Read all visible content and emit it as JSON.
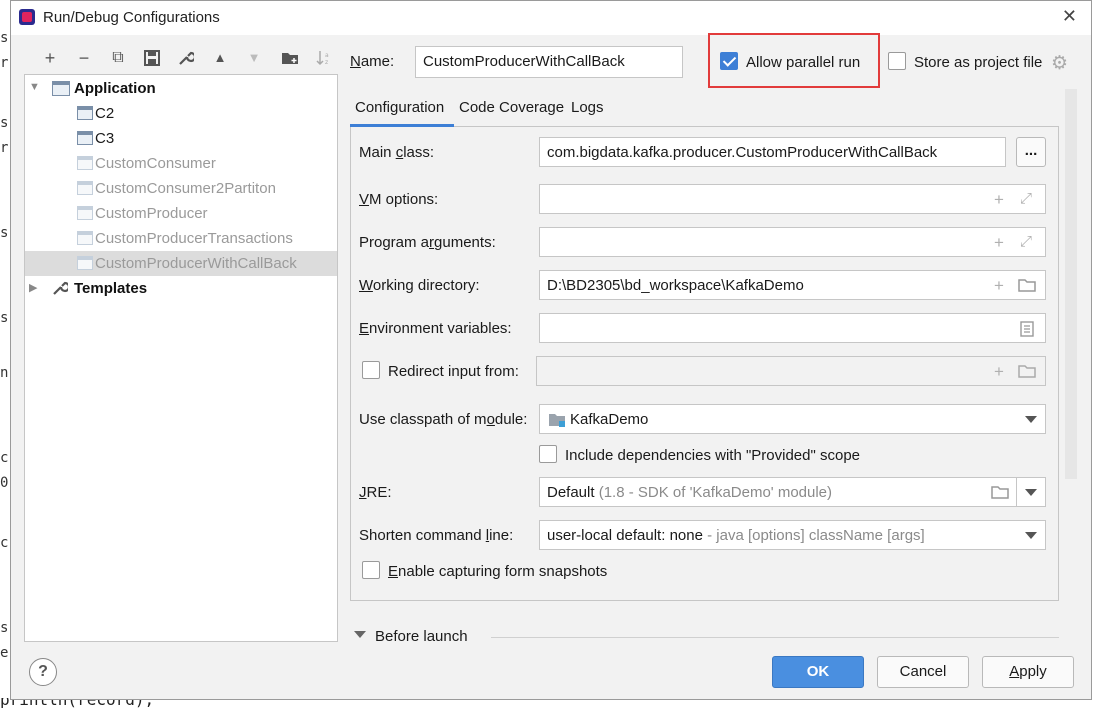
{
  "window": {
    "title": "Run/Debug Configurations",
    "close_glyph": "✕"
  },
  "background": {
    "edge_chars": [
      "s",
      "r",
      "s",
      "r",
      "s",
      "s",
      "n",
      "c",
      "0",
      "c",
      "s",
      "e"
    ],
    "bottom_code": "println(record);"
  },
  "toolbar": {
    "icons": [
      "plus-icon",
      "minus-icon",
      "copy-icon",
      "save-icon",
      "wrench-icon",
      "arrow-up-icon",
      "arrow-down-icon",
      "folder-add-icon",
      "sort-icon"
    ],
    "glyphs": {
      "add": "+",
      "remove": "−",
      "copy": "⧉",
      "save": "🖫",
      "wrench": "🔧",
      "up": "▲",
      "down": "▼",
      "folder": "📁",
      "sort": "↓"
    }
  },
  "tree": {
    "application_label": "Application",
    "items": [
      {
        "label": "C2",
        "enabled": true
      },
      {
        "label": "C3",
        "enabled": true
      },
      {
        "label": "CustomConsumer",
        "enabled": false
      },
      {
        "label": "CustomConsumer2Partiton",
        "enabled": false
      },
      {
        "label": "CustomProducer",
        "enabled": false
      },
      {
        "label": "CustomProducerTransactions",
        "enabled": false
      },
      {
        "label": "CustomProducerWithCallBack",
        "enabled": false,
        "selected": true
      }
    ],
    "templates_label": "Templates"
  },
  "header": {
    "name_label": "Name:",
    "name_value": "CustomProducerWithCallBack",
    "allow_parallel_label": "Allow parallel run",
    "allow_parallel_checked": true,
    "store_project_label": "Store as project file",
    "store_project_checked": false
  },
  "tabs": [
    "Configuration",
    "Code Coverage",
    "Logs"
  ],
  "active_tab": "Configuration",
  "form": {
    "main_class_label": "Main class:",
    "main_class_value": "com.bigdata.kafka.producer.CustomProducerWithCallBack",
    "browse_label": "...",
    "vm_options_label": "VM options:",
    "vm_options_value": "",
    "program_args_label": "Program arguments:",
    "program_args_value": "",
    "working_dir_label": "Working directory:",
    "working_dir_value": "D:\\BD2305\\bd_workspace\\KafkaDemo",
    "env_vars_label": "Environment variables:",
    "env_vars_value": "",
    "redirect_label": "Redirect input from:",
    "redirect_checked": false,
    "classpath_label": "Use classpath of module:",
    "classpath_value": "KafkaDemo",
    "include_deps_label": "Include dependencies with \"Provided\" scope",
    "include_deps_checked": false,
    "jre_label": "JRE:",
    "jre_value": "Default",
    "jre_hint": "(1.8 - SDK of 'KafkaDemo' module)",
    "shorten_label": "Shorten command line:",
    "shorten_value": "user-local default: none",
    "shorten_hint": "- java [options] className [args]",
    "capture_label": "Enable capturing form snapshots",
    "capture_checked": false
  },
  "before_launch_label": "Before launch",
  "buttons": {
    "ok": "OK",
    "cancel": "Cancel",
    "apply": "Apply",
    "help": "?"
  },
  "colors": {
    "accent": "#3d7fd6",
    "highlight": "#e23b3b",
    "ok_button": "#4a8fe0"
  }
}
